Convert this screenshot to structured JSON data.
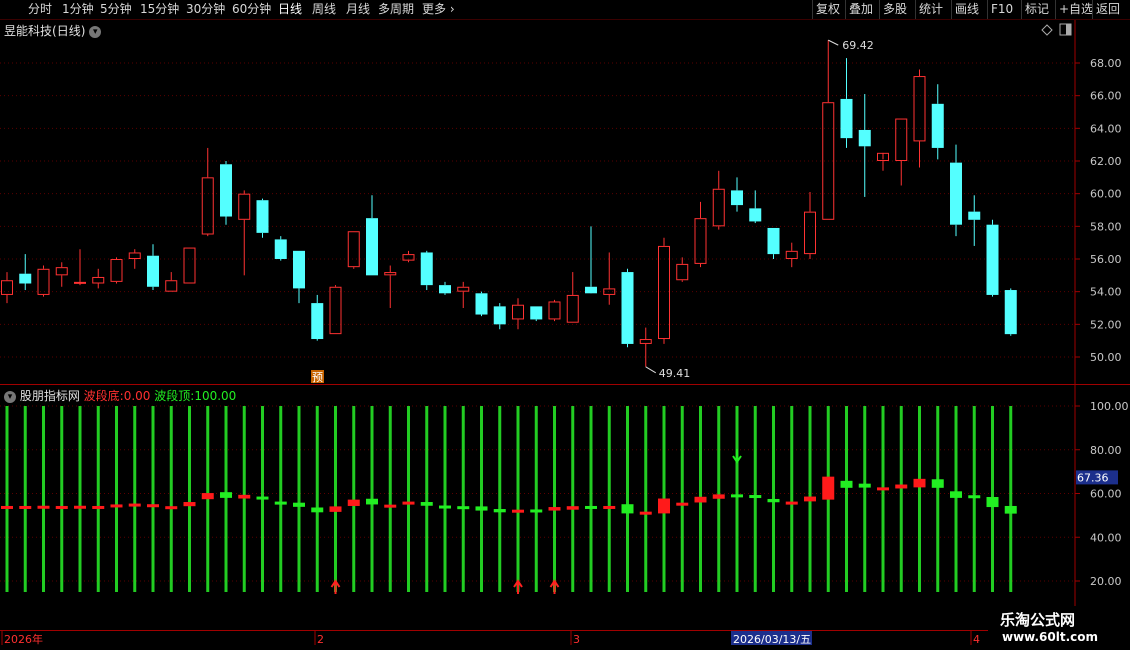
{
  "toolbar": {
    "periods": [
      "分时",
      "1分钟",
      "5分钟",
      "15分钟",
      "30分钟",
      "60分钟",
      "日线",
      "周线",
      "月线",
      "多周期",
      "更多"
    ],
    "active_period": "日线",
    "tools": [
      "复权",
      "叠加",
      "多股",
      "统计",
      "画线",
      "F10",
      "标记",
      "+自选",
      "返回"
    ]
  },
  "stock": {
    "name": "昱能科技",
    "period_label": "(日线)"
  },
  "main_chart": {
    "y_ticks": [
      "68.00",
      "66.00",
      "64.00",
      "62.00",
      "60.00",
      "58.00",
      "56.00",
      "54.00",
      "52.00",
      "50.00"
    ],
    "high_label": "69.42",
    "low_label": "49.41",
    "marker_label": "预"
  },
  "indicator": {
    "name": "股朋指标网",
    "bottom_label": "波段底:",
    "bottom_value": "0.00",
    "top_label": "波段顶:",
    "top_value": "100.00",
    "y_ticks": [
      "100.00",
      "80.00",
      "60.00",
      "40.00",
      "20.00"
    ],
    "current_value": "67.36"
  },
  "date_axis": {
    "labels": [
      "2026年",
      "2",
      "3",
      "4"
    ],
    "cursor_date": "2026/03/13/五"
  },
  "watermark": {
    "line1": "乐淘公式网",
    "line2": "www.60lt.com"
  },
  "colors": {
    "up": "#ff3232",
    "down": "#54ffff",
    "ind_up": "#ff1a1a",
    "ind_down": "#22ee22",
    "bar": "#22cc22",
    "axis": "#a00000"
  },
  "chart_data": {
    "type": "candlestick",
    "y_range": [
      49,
      69.5
    ],
    "ohlc": [
      [
        53.8,
        55.2,
        53.3,
        54.7
      ],
      [
        55.1,
        56.3,
        54.1,
        54.5
      ],
      [
        53.8,
        55.6,
        53.7,
        55.4
      ],
      [
        55.0,
        55.8,
        54.3,
        55.5
      ],
      [
        54.6,
        56.6,
        54.4,
        54.6
      ],
      [
        54.5,
        55.4,
        54.2,
        54.9
      ],
      [
        54.6,
        56.1,
        54.5,
        56.0
      ],
      [
        56.0,
        56.6,
        55.4,
        56.4
      ],
      [
        56.2,
        56.9,
        54.1,
        54.3
      ],
      [
        54.0,
        55.2,
        54.0,
        54.7
      ],
      [
        54.5,
        56.7,
        54.5,
        56.7
      ],
      [
        57.5,
        62.8,
        57.4,
        61.0
      ],
      [
        61.8,
        62.0,
        58.1,
        58.6
      ],
      [
        58.4,
        60.2,
        55.0,
        60.0
      ],
      [
        59.6,
        59.7,
        57.3,
        57.6
      ],
      [
        57.2,
        57.4,
        55.9,
        56.0
      ],
      [
        56.5,
        56.5,
        53.3,
        54.2
      ],
      [
        53.3,
        53.8,
        51.0,
        51.1
      ],
      [
        51.4,
        54.4,
        51.4,
        54.3
      ],
      [
        55.5,
        57.7,
        55.4,
        57.7
      ],
      [
        58.5,
        59.9,
        55.0,
        55.0
      ],
      [
        55.0,
        55.6,
        53.0,
        55.2
      ],
      [
        55.9,
        56.5,
        55.8,
        56.3
      ],
      [
        56.4,
        56.5,
        54.1,
        54.4
      ],
      [
        54.4,
        54.6,
        53.8,
        53.9
      ],
      [
        54.0,
        54.6,
        53.0,
        54.3
      ],
      [
        53.9,
        54.0,
        52.5,
        52.6
      ],
      [
        53.1,
        53.3,
        51.7,
        52.0
      ],
      [
        52.3,
        53.6,
        51.7,
        53.2
      ],
      [
        53.1,
        53.1,
        52.2,
        52.3
      ],
      [
        52.3,
        53.5,
        52.2,
        53.4
      ],
      [
        52.1,
        55.2,
        52.1,
        53.8
      ],
      [
        54.3,
        58.0,
        54.0,
        53.9
      ],
      [
        53.8,
        56.4,
        53.2,
        54.2
      ],
      [
        55.2,
        55.4,
        50.6,
        50.8
      ],
      [
        50.8,
        51.8,
        49.4,
        51.1
      ],
      [
        51.1,
        57.3,
        50.8,
        56.8
      ],
      [
        54.7,
        56.1,
        54.6,
        55.7
      ],
      [
        55.7,
        59.5,
        55.5,
        58.5
      ],
      [
        58.0,
        61.4,
        57.8,
        60.3
      ],
      [
        60.2,
        61.0,
        58.9,
        59.3
      ],
      [
        59.1,
        60.2,
        58.2,
        58.3
      ],
      [
        57.9,
        57.9,
        56.0,
        56.3
      ],
      [
        56.0,
        57.0,
        55.5,
        56.5
      ],
      [
        56.3,
        60.1,
        56.0,
        58.9
      ],
      [
        58.4,
        69.4,
        58.4,
        65.6
      ],
      [
        65.8,
        68.3,
        62.8,
        63.4
      ],
      [
        63.9,
        66.1,
        59.8,
        62.9
      ],
      [
        62.0,
        62.1,
        61.4,
        62.5
      ],
      [
        62.0,
        64.6,
        60.5,
        64.6
      ],
      [
        63.2,
        67.6,
        61.6,
        67.2
      ],
      [
        65.5,
        66.7,
        62.1,
        62.8
      ],
      [
        61.9,
        63.0,
        57.4,
        58.1
      ],
      [
        58.9,
        59.9,
        56.8,
        58.4
      ],
      [
        58.1,
        58.4,
        53.7,
        53.8
      ],
      [
        54.1,
        54.2,
        51.3,
        51.4
      ]
    ],
    "indicator_values": [
      [
        53.8,
        54.3
      ],
      [
        53.8,
        54.3
      ],
      [
        53.6,
        54.4
      ],
      [
        54.0,
        54.3
      ],
      [
        54.0,
        54.4
      ],
      [
        53.9,
        54.3
      ],
      [
        54.3,
        55.0
      ],
      [
        54.8,
        55.4
      ],
      [
        54.0,
        55.1
      ],
      [
        53.9,
        54.2
      ],
      [
        54.2,
        56.1
      ],
      [
        57.4,
        60.2
      ],
      [
        60.6,
        58.0
      ],
      [
        57.7,
        59.4
      ],
      [
        58.6,
        57.4
      ],
      [
        56.3,
        55.0
      ],
      [
        55.8,
        53.9
      ],
      [
        53.6,
        51.4
      ],
      [
        51.6,
        54.1
      ],
      [
        54.3,
        57.2
      ],
      [
        57.6,
        55.0
      ],
      [
        54.6,
        54.9
      ],
      [
        55.0,
        56.3
      ],
      [
        56.1,
        54.4
      ],
      [
        54.5,
        53.8
      ],
      [
        54.2,
        53.9
      ],
      [
        54.1,
        52.2
      ],
      [
        52.9,
        51.4
      ],
      [
        51.8,
        52.6
      ],
      [
        52.7,
        52.0
      ],
      [
        52.2,
        53.8
      ],
      [
        52.6,
        54.2
      ],
      [
        54.3,
        53.7
      ],
      [
        54.1,
        54.3
      ],
      [
        55.1,
        50.9
      ],
      [
        51.2,
        51.7
      ],
      [
        50.9,
        57.7
      ],
      [
        54.6,
        55.8
      ],
      [
        55.9,
        58.5
      ],
      [
        57.6,
        59.6
      ],
      [
        59.6,
        58.6
      ],
      [
        59.3,
        58.0
      ],
      [
        57.5,
        56.0
      ],
      [
        56.0,
        56.3
      ],
      [
        56.4,
        58.6
      ],
      [
        57.2,
        67.7
      ],
      [
        65.8,
        62.6
      ],
      [
        64.5,
        62.7
      ],
      [
        61.5,
        62.8
      ],
      [
        62.3,
        64.1
      ],
      [
        62.8,
        66.7
      ],
      [
        66.5,
        62.6
      ],
      [
        61.0,
        58.0
      ],
      [
        59.2,
        58.1
      ],
      [
        58.4,
        53.8
      ],
      [
        54.3,
        50.8
      ]
    ],
    "indicator_y_range": [
      10,
      105
    ],
    "buy_signal_indices": [
      18,
      28,
      30
    ],
    "sell_signal_indices": [
      40
    ]
  }
}
